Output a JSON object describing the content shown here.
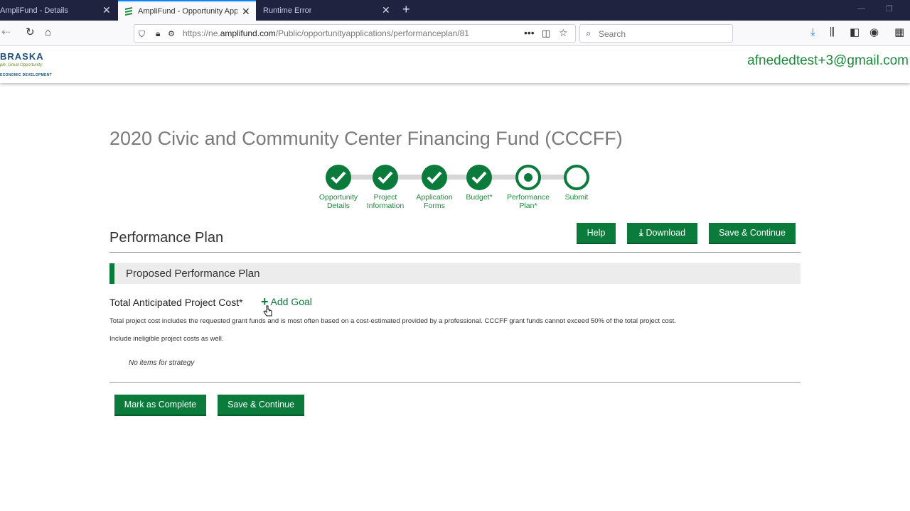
{
  "browser": {
    "tabs": [
      {
        "label": "AmpliFund - Details",
        "active": false
      },
      {
        "label": "AmpliFund - Opportunity App",
        "active": true
      },
      {
        "label": "Runtime Error",
        "active": false
      }
    ],
    "url_prefix": "https://ne.",
    "url_host": "amplifund.com",
    "url_path": "/Public/opportunityapplications/performanceplan/81",
    "search_placeholder": "Search"
  },
  "header": {
    "logo_main": "BRASKA",
    "logo_tagline": "ple. Great Opportunity.",
    "logo_sub": "ECONOMIC DEVELOPMENT",
    "user_email": "afnededtest+3@gmail.com"
  },
  "page": {
    "title": "2020 Civic and Community Center Financing Fund (CCCFF)"
  },
  "steps": [
    {
      "label": "Opportunity Details",
      "state": "done"
    },
    {
      "label": "Project Information",
      "state": "done"
    },
    {
      "label": "Application Forms",
      "state": "done"
    },
    {
      "label": "Budget*",
      "state": "done"
    },
    {
      "label": "Performance Plan*",
      "state": "current"
    },
    {
      "label": "Submit",
      "state": "todo"
    }
  ],
  "section": {
    "title": "Performance Plan",
    "help_label": "Help",
    "download_label": "Download",
    "save_continue_label": "Save & Continue"
  },
  "panel": {
    "title": "Proposed Performance Plan",
    "field_label": "Total Anticipated Project Cost*",
    "add_goal_label": "Add Goal",
    "help_text_1": "Total project cost includes the requested grant funds and is most often based on a cost-estimated provided by a professional. CCCFF grant funds cannot exceed 50% of the total project cost.",
    "help_text_2": "Include ineligible project costs as well.",
    "empty_text": "No items for strategy"
  },
  "footer_actions": {
    "mark_complete_label": "Mark as Complete",
    "save_continue_label": "Save & Continue"
  },
  "colors": {
    "brand_green": "#0b7b3b",
    "tab_strip": "#202340"
  }
}
